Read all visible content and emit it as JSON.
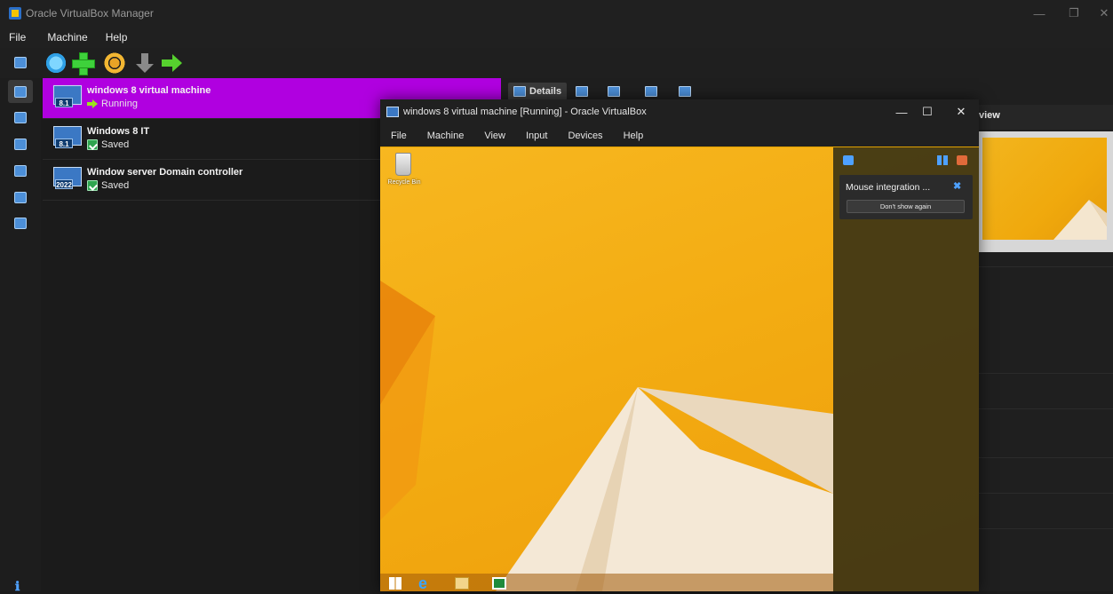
{
  "window": {
    "title": "Oracle VirtualBox Manager"
  },
  "menu": [
    "File",
    "Machine",
    "Help"
  ],
  "toolbar": {
    "icons": [
      "new-burst-icon",
      "add-icon",
      "settings-gear-icon",
      "discard-arrow-icon",
      "start-arrow-icon"
    ]
  },
  "vms": [
    {
      "name": "windows 8 virtual machine",
      "os_badge": "8.1",
      "state": "Running",
      "state_icon": "running-arrow-icon",
      "selected": true
    },
    {
      "name": "Windows 8 IT",
      "os_badge": "8.1",
      "state": "Saved",
      "state_icon": "saved-state-icon",
      "selected": false
    },
    {
      "name": "Window server Domain controller",
      "os_badge": "2022",
      "state": "Saved",
      "state_icon": "saved-state-icon",
      "selected": false
    }
  ],
  "details": {
    "tabs": [
      {
        "label": "Details",
        "active": true
      }
    ],
    "preview_header": "view"
  },
  "vm_window": {
    "title": "windows 8 virtual machine [Running] - Oracle VirtualBox",
    "menu": [
      "File",
      "Machine",
      "View",
      "Input",
      "Devices",
      "Help"
    ],
    "desktop": {
      "recycle_label": "Recycle Bin"
    },
    "notification": {
      "message": "Mouse integration ...",
      "button": "Don't show again"
    }
  },
  "colors": {
    "selection": "#b000e0",
    "wallpaper": "#f3ac12",
    "accent_blue": "#4ea1ff"
  }
}
